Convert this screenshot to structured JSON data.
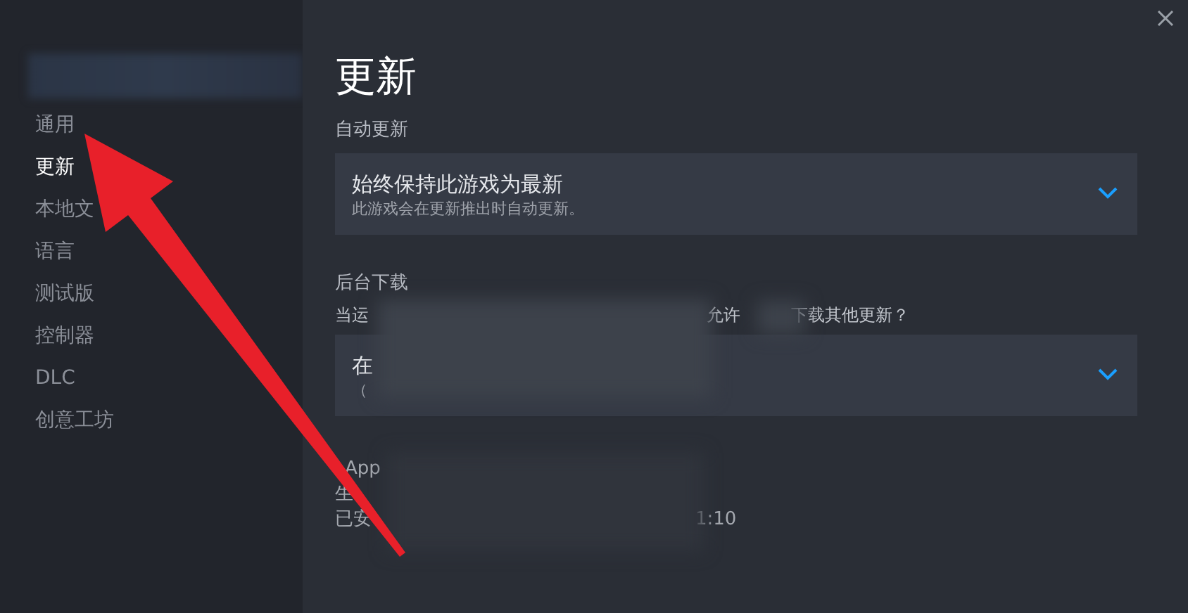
{
  "sidebar": {
    "items": [
      {
        "label": "通用",
        "selected": false
      },
      {
        "label": "更新",
        "selected": true
      },
      {
        "label": "本地文",
        "selected": false
      },
      {
        "label": "语言",
        "selected": false
      },
      {
        "label": "测试版",
        "selected": false
      },
      {
        "label": "控制器",
        "selected": false
      },
      {
        "label": "DLC",
        "selected": false
      },
      {
        "label": "创意工坊",
        "selected": false
      }
    ]
  },
  "page": {
    "title": "更新"
  },
  "sections": [
    {
      "label": "自动更新",
      "dropdown": {
        "value": "始终保持此游戏为最新",
        "description": "此游戏会在更新推出时自动更新。"
      }
    },
    {
      "label": "后台下载",
      "hint_parts": [
        "当运",
        "允许",
        "下载其他更新？"
      ],
      "dropdown": {
        "value": "在",
        "description": "（"
      }
    }
  ],
  "info_lines": [
    {
      "label": "App"
    },
    {
      "label": "生"
    },
    {
      "label": "已安",
      "value": "1:10"
    }
  ]
}
